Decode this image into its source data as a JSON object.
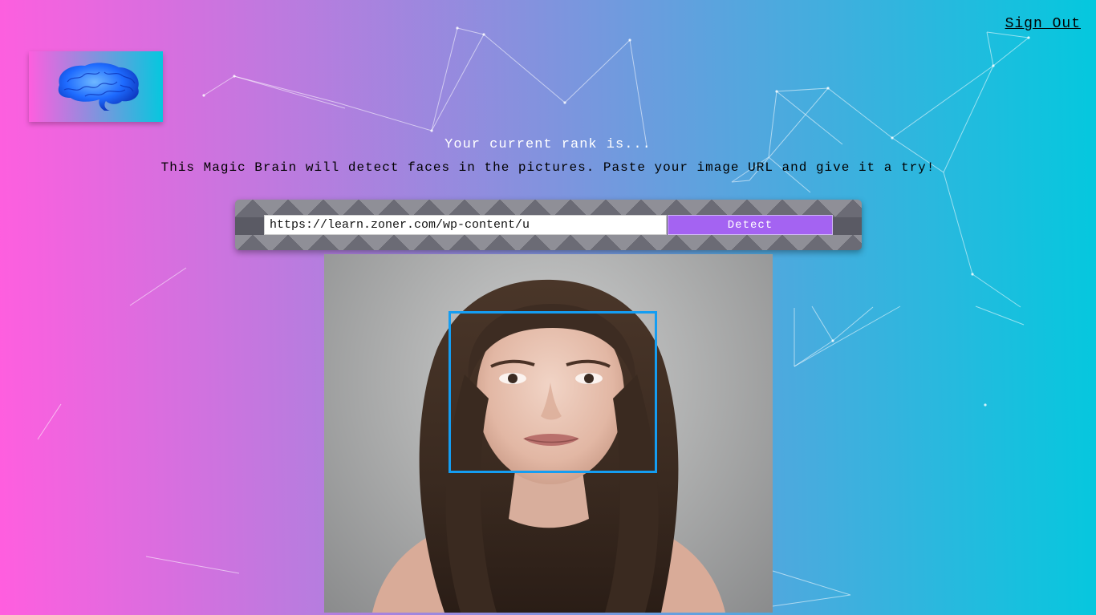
{
  "nav": {
    "sign_out_label": "Sign Out"
  },
  "logo": {
    "icon": "brain-icon",
    "brand_color": "#1e6bff"
  },
  "rank": {
    "text": "Your current rank is..."
  },
  "intro": {
    "text": "This Magic Brain will detect faces in the pictures. Paste your image URL and give it a try!"
  },
  "form": {
    "url_value": "https://learn.zoner.com/wp-content/u",
    "detect_label": "Detect",
    "detect_color": "#a463f2"
  },
  "result": {
    "face_box_color": "#149df2"
  },
  "theme": {
    "gradient_start": "#ff5edf",
    "gradient_end": "#04c8de"
  }
}
